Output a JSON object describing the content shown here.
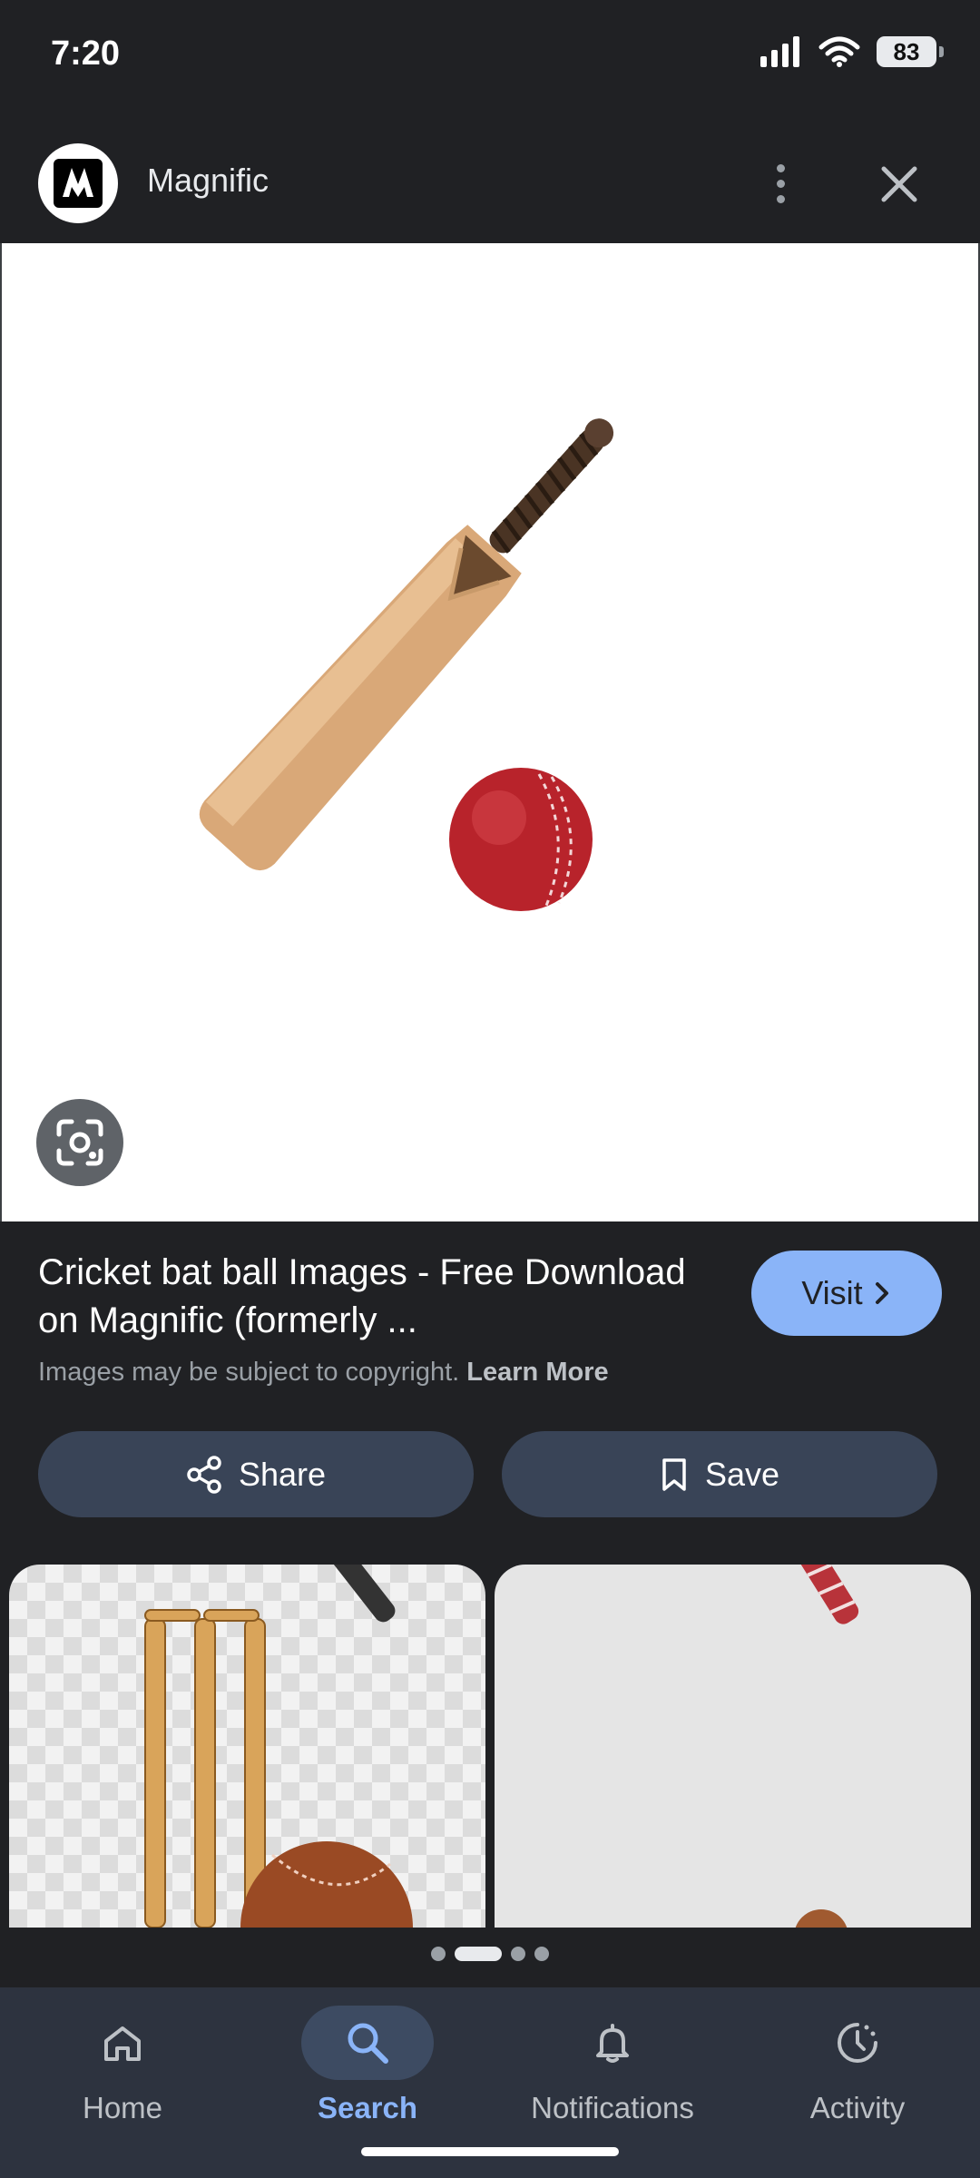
{
  "status": {
    "time": "7:20",
    "battery": "83"
  },
  "header": {
    "site_name": "Magnific"
  },
  "result": {
    "title": "Cricket bat ball Images - Free Download on Magnific (formerly ...",
    "copyright_text": "Images may be subject to copyright.",
    "learn_more": "Learn More",
    "visit_label": "Visit"
  },
  "actions": {
    "share_label": "Share",
    "save_label": "Save"
  },
  "carousel": {
    "pages": 4,
    "active": 1
  },
  "nav": {
    "items": [
      {
        "label": "Home",
        "icon": "home-icon"
      },
      {
        "label": "Search",
        "icon": "search-icon",
        "active": true
      },
      {
        "label": "Notifications",
        "icon": "bell-icon"
      },
      {
        "label": "Activity",
        "icon": "activity-icon"
      }
    ]
  },
  "colors": {
    "accent": "#8ab4f8",
    "background": "#202124",
    "button": "#394457"
  }
}
